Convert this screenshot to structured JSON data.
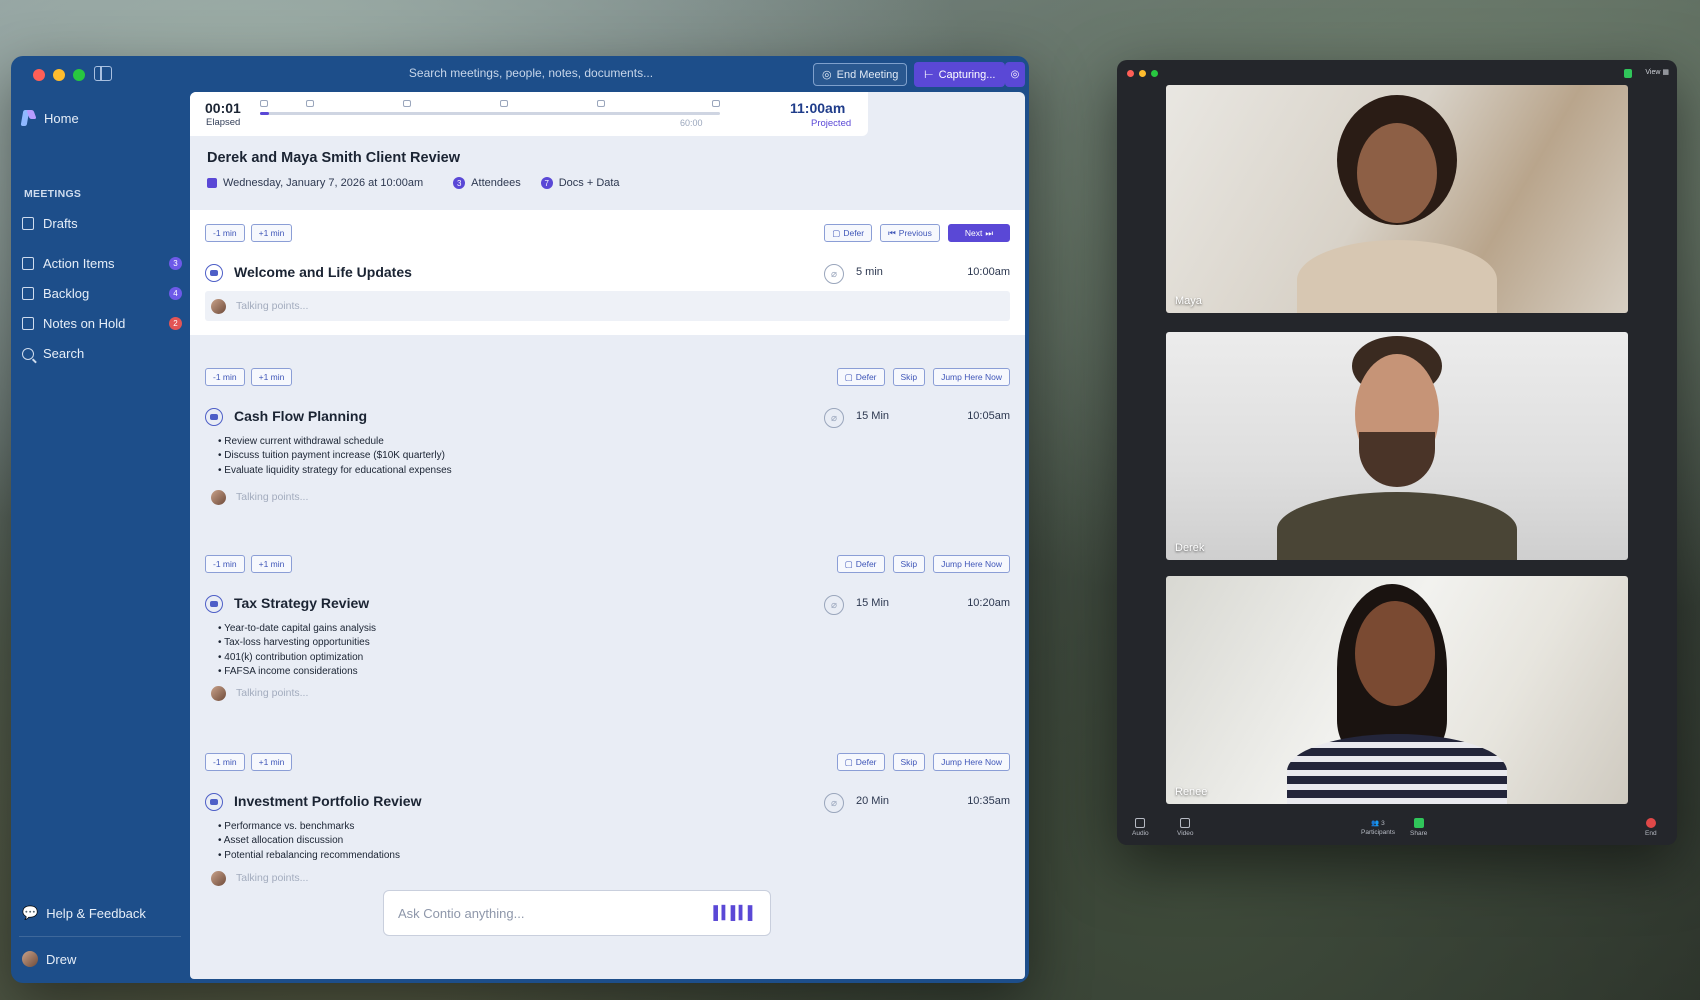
{
  "app": {
    "search_placeholder": "Search meetings, people, notes, documents...",
    "end_meeting_label": "End Meeting",
    "capturing_label": "Capturing...",
    "sidebar": {
      "home": "Home",
      "section": "MEETINGS",
      "items": [
        {
          "label": "Drafts",
          "badge": ""
        },
        {
          "label": "Action Items",
          "badge": "3"
        },
        {
          "label": "Backlog",
          "badge": "4"
        },
        {
          "label": "Notes on Hold",
          "badge": "2"
        },
        {
          "label": "Search",
          "badge": ""
        }
      ],
      "help": "Help & Feedback",
      "user": "Drew"
    },
    "timer": {
      "elapsed": "00:01",
      "elapsed_label": "Elapsed",
      "scale_end": "60:00",
      "projected": "11:00am",
      "projected_label": "Projected",
      "progress_fraction": 0.02
    },
    "meeting": {
      "title": "Derek and Maya Smith Client Review",
      "date": "Wednesday, January 7, 2026 at 10:00am",
      "attendees_count": "3",
      "attendees_label": "Attendees",
      "docs_count": "7",
      "docs_label": "Docs + Data"
    },
    "controls": {
      "minus": "-1 min",
      "plus": "+1 min",
      "defer": "Defer",
      "previous": "Previous",
      "next": "Next",
      "skip": "Skip",
      "jump": "Jump Here Now",
      "talking_points": "Talking points..."
    },
    "agenda": [
      {
        "title": "Welcome and Life Updates",
        "duration": "5 min",
        "start": "10:00am",
        "bullets": []
      },
      {
        "title": "Cash Flow Planning",
        "duration": "15 Min",
        "start": "10:05am",
        "bullets": [
          "Review current withdrawal schedule",
          "Discuss tuition payment increase ($10K quarterly)",
          "Evaluate liquidity strategy for educational expenses"
        ]
      },
      {
        "title": "Tax Strategy Review",
        "duration": "15 Min",
        "start": "10:20am",
        "bullets": [
          "Year-to-date capital gains analysis",
          "Tax-loss harvesting opportunities",
          "401(k) contribution optimization",
          "FAFSA income considerations"
        ]
      },
      {
        "title": "Investment Portfolio Review",
        "duration": "20 Min",
        "start": "10:35am",
        "bullets": [
          "Performance vs. benchmarks",
          "Asset allocation discussion",
          "Potential rebalancing recommendations"
        ]
      }
    ],
    "ask_placeholder": "Ask Contio anything..."
  },
  "video": {
    "view_label": "View",
    "participants": [
      "Maya",
      "Derek",
      "Renee"
    ],
    "toolbar": {
      "audio": "Audio",
      "video": "Video",
      "participants": "Participants",
      "participants_count": "3",
      "share": "Share",
      "end": "End"
    }
  },
  "colors": {
    "accent": "#5a48d6",
    "sidebar": "#1d4e8a",
    "content_bg": "#e9edf5"
  }
}
